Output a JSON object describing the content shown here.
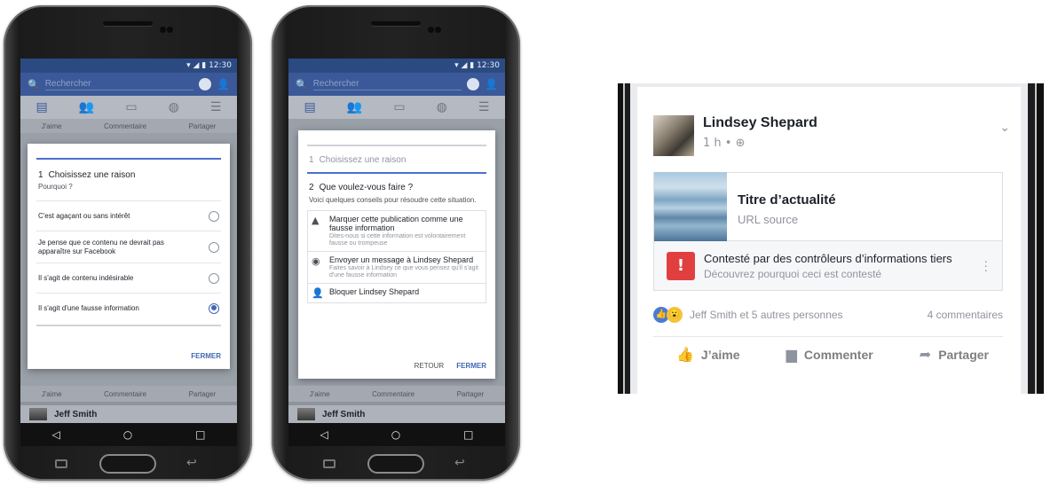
{
  "status": {
    "time": "12:30"
  },
  "search": {
    "placeholder": "Rechercher"
  },
  "feed": {
    "like": "J'aime",
    "comment": "Commentaire",
    "share": "Partager",
    "author": "Jeff Smith"
  },
  "dialog1": {
    "step_num": "1",
    "step_title": "Choisissez une raison",
    "subtitle": "Pourquoi ?",
    "options": [
      {
        "label": "C'est agaçant ou sans intérêt",
        "selected": false
      },
      {
        "label": "Je pense que ce contenu ne devrait pas apparaître sur Facebook",
        "selected": false
      },
      {
        "label": "Il s'agit de contenu indésirable",
        "selected": false
      },
      {
        "label": "Il s'agit d'une fausse information",
        "selected": true
      }
    ],
    "close": "FERMER"
  },
  "dialog2": {
    "step1_num": "1",
    "step1_title": "Choisissez une raison",
    "step2_num": "2",
    "step2_title": "Que voulez-vous faire ?",
    "subtitle": "Voici quelques conseils pour résoudre cette situation.",
    "cards": [
      {
        "icon": "warning-icon",
        "title": "Marquer cette publication comme une fausse information",
        "desc": "Dites-nous si cette information est volontairement fausse ou trompeuse"
      },
      {
        "icon": "messenger-icon",
        "title": "Envoyer un message à Lindsey Shepard",
        "desc": "Faites savoir à Lindsey ce que vous pensez qu'il s'agit d'une fausse information"
      },
      {
        "icon": "block-user-icon",
        "title": "Bloquer Lindsey Shepard",
        "desc": ""
      }
    ],
    "back": "RETOUR",
    "close": "FERMER"
  },
  "post": {
    "user": "Lindsey Shepard",
    "meta": "1 h • ⊕",
    "link_title": "Titre d’actualité",
    "link_url": "URL source",
    "disputed_title": "Contesté par des contrôleurs d’informations tiers",
    "disputed_sub": "Découvrez pourquoi ceci est contesté",
    "reactions_text": "Jeff Smith et 5 autres personnes",
    "comments_count": "4 commentaires",
    "like": "J’aime",
    "comment": "Commenter",
    "share": "Partager"
  }
}
